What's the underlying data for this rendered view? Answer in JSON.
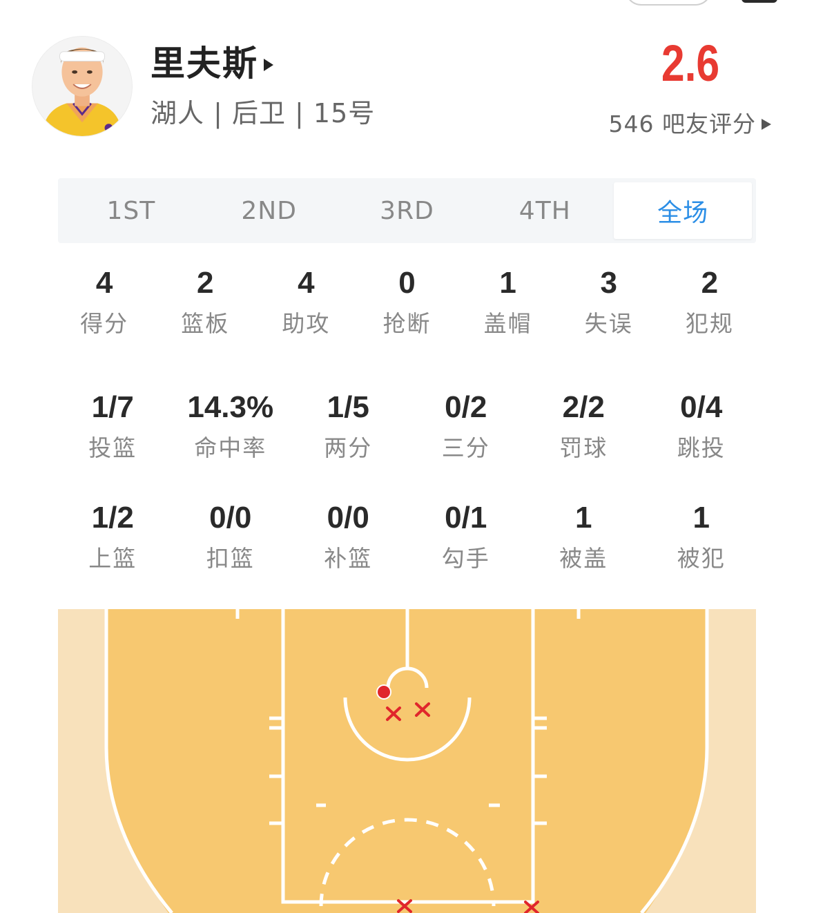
{
  "player": {
    "name": "里夫斯",
    "info": "湖人 | 后卫 | 15号"
  },
  "rating": {
    "score": "2.6",
    "count_label": "546 吧友评分"
  },
  "period_tabs": [
    {
      "label": "1ST",
      "active": false
    },
    {
      "label": "2ND",
      "active": false
    },
    {
      "label": "3RD",
      "active": false
    },
    {
      "label": "4TH",
      "active": false
    },
    {
      "label": "全场",
      "active": true
    }
  ],
  "basic_stats": [
    {
      "value": "4",
      "label": "得分"
    },
    {
      "value": "2",
      "label": "篮板"
    },
    {
      "value": "4",
      "label": "助攻"
    },
    {
      "value": "0",
      "label": "抢断"
    },
    {
      "value": "1",
      "label": "盖帽"
    },
    {
      "value": "3",
      "label": "失误"
    },
    {
      "value": "2",
      "label": "犯规"
    }
  ],
  "shooting_stats": [
    {
      "value": "1/7",
      "label": "投篮"
    },
    {
      "value": "14.3%",
      "label": "命中率"
    },
    {
      "value": "1/5",
      "label": "两分"
    },
    {
      "value": "0/2",
      "label": "三分"
    },
    {
      "value": "2/2",
      "label": "罚球"
    },
    {
      "value": "0/4",
      "label": "跳投"
    }
  ],
  "shot_type_stats": [
    {
      "value": "1/2",
      "label": "上篮"
    },
    {
      "value": "0/0",
      "label": "扣篮"
    },
    {
      "value": "0/0",
      "label": "补篮"
    },
    {
      "value": "0/1",
      "label": "勾手"
    },
    {
      "value": "1",
      "label": "被盖"
    },
    {
      "value": "1",
      "label": "被犯"
    }
  ],
  "colors": {
    "accent_red": "#e83a32",
    "tab_active_blue": "#2b8ee6",
    "court_inner": "#f7c870",
    "court_outer": "#f8e1bb",
    "shot_marker": "#e0262c"
  },
  "icons": {
    "name_arrow": "play-arrow-icon",
    "rating_arrow": "play-arrow-icon"
  }
}
